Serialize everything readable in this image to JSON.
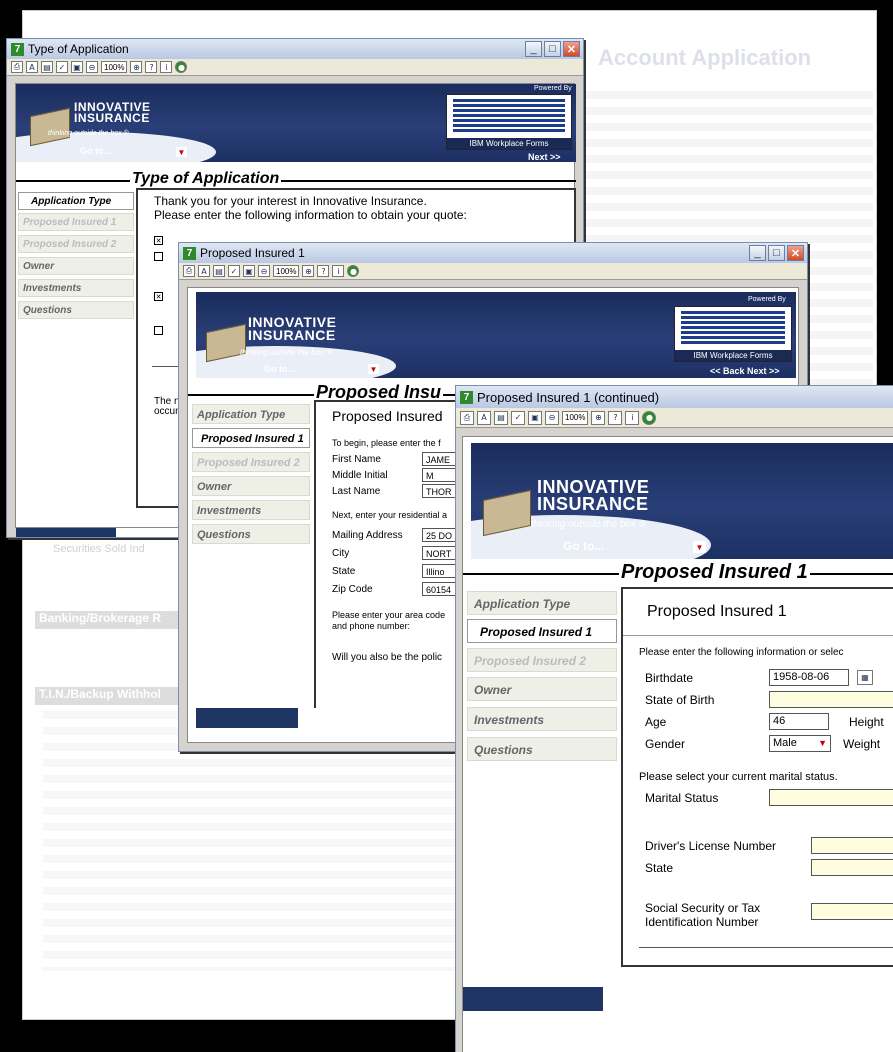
{
  "background_doc": {
    "title": "Account Application",
    "section1": "Banking/Brokerage R",
    "section2": "T.I.N./Backup Withhol",
    "footer_text": "Securities Sold Ind"
  },
  "window1": {
    "title": "Type of Application",
    "zoom": "100%",
    "brand_line1": "INNOVATIVE",
    "brand_line2": "INSURANCE",
    "tagline": "thinking outside the box ®",
    "goto": "Go to...",
    "powered": "Powered By",
    "ibm_caption": "IBM Workplace Forms",
    "nav_next": "Next >>",
    "page_title": "Type of Application",
    "side_items": [
      "Application Type",
      "Proposed Insured 1",
      "Proposed Insured 2",
      "Owner",
      "Investments",
      "Questions"
    ],
    "intro1": "Thank you for your interest in Innovative Insurance.",
    "intro2": "Please enter the following information to obtain your quote:",
    "bottom_text1": "The ni",
    "bottom_text2": "occum"
  },
  "window2": {
    "title": "Proposed Insured 1",
    "zoom": "100%",
    "brand_line1": "INNOVATIVE",
    "brand_line2": "INSURANCE",
    "tagline": "thinking outside the box ®",
    "goto": "Go to...",
    "powered": "Powered By",
    "ibm_caption": "IBM Workplace Forms",
    "nav": "<< Back  Next >>",
    "page_title": "Proposed Insu",
    "side_items": [
      "Application Type",
      "Proposed Insured 1",
      "Proposed Insured 2",
      "Owner",
      "Investments",
      "Questions"
    ],
    "panel_title": "Proposed Insured",
    "begin_text": "To begin, please enter the f",
    "first_name_label": "First Name",
    "first_name": "JAME",
    "middle_label": "Middle Initial",
    "middle": "M",
    "last_name_label": "Last Name",
    "last_name": "THOR",
    "residential_text": "Next, enter your residential a",
    "address_label": "Mailing Address",
    "address": "25 DO",
    "city_label": "City",
    "city": "NORT",
    "state_label": "State",
    "state": "Illino",
    "zip_label": "Zip Code",
    "zip": "60154",
    "phone_text1": "Please enter your area code",
    "phone_text2": "and phone number:",
    "policy_text": "Will you also be the polic"
  },
  "window3": {
    "title": "Proposed Insured 1 (continued)",
    "zoom": "100%",
    "brand_line1": "INNOVATIVE",
    "brand_line2": "INSURANCE",
    "tagline": "thinking outside the box ®",
    "goto": "Go to...",
    "page_title": "Proposed Insured 1",
    "side_items": [
      "Application Type",
      "Proposed Insured 1",
      "Proposed Insured 2",
      "Owner",
      "Investments",
      "Questions"
    ],
    "panel_title": "Proposed Insured 1",
    "instruction": "Please enter the following information or selec",
    "birthdate_label": "Birthdate",
    "birthdate": "1958-08-06",
    "state_birth_label": "State of Birth",
    "state_birth": "",
    "age_label": "Age",
    "age": "46",
    "height_label": "Height",
    "gender_label": "Gender",
    "gender": "Male",
    "weight_label": "Weight",
    "marital_text": "Please select your current marital status.",
    "marital_label": "Marital Status",
    "marital": "",
    "license_label": "Driver's License Number",
    "license_state_label": "State",
    "ssn_label1": "Social Security or Tax",
    "ssn_label2": "Identification Number"
  }
}
